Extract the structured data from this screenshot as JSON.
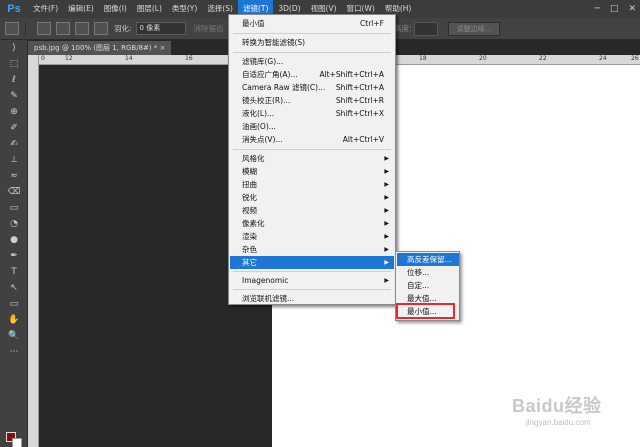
{
  "app": {
    "logo": "Ps"
  },
  "menubar": {
    "items": [
      "文件(F)",
      "编辑(E)",
      "图像(I)",
      "图层(L)",
      "类型(Y)",
      "选择(S)",
      "滤镜(T)",
      "3D(D)",
      "视图(V)",
      "窗口(W)",
      "帮助(H)"
    ],
    "active_index": 6
  },
  "window_controls": {
    "minimize": "─",
    "maximize": "□",
    "close": "✕"
  },
  "options_bar": {
    "feather_label": "羽化:",
    "feather_value": "0 像素",
    "antialias_label": "消除锯齿",
    "height_label": "高度:",
    "refine_edge_label": "调整边缘..."
  },
  "document": {
    "tab_title": "psb.jpg @ 100% (图层 1, RGB/8#) *",
    "tab_close": "×",
    "ruler_numbers": [
      "0",
      "12",
      "14",
      "16",
      "18",
      "20",
      "22",
      "24",
      "26"
    ]
  },
  "toolbox": {
    "tools": [
      "⟩",
      "⬚",
      "ℓ",
      "✎",
      "⊕",
      "✐",
      "✍",
      "⊥",
      "≈",
      "⌫",
      "▭",
      "◔",
      "●",
      "✒",
      "T",
      "↖",
      "▭",
      "✋",
      "🔍",
      "⋯"
    ],
    "foreground_color": "#8c0a0a",
    "background_color": "#ffffff"
  },
  "filter_menu": {
    "items": [
      {
        "label": "最小值",
        "shortcut": "Ctrl+F"
      },
      {
        "label": "转换为智能滤镜(S)"
      },
      {
        "label": "滤镜库(G)..."
      },
      {
        "label": "自适应广角(A)...",
        "shortcut": "Alt+Shift+Ctrl+A"
      },
      {
        "label": "Camera Raw 滤镜(C)...",
        "shortcut": "Shift+Ctrl+A"
      },
      {
        "label": "镜头校正(R)...",
        "shortcut": "Shift+Ctrl+R"
      },
      {
        "label": "液化(L)...",
        "shortcut": "Shift+Ctrl+X"
      },
      {
        "label": "油画(O)..."
      },
      {
        "label": "消失点(V)...",
        "shortcut": "Alt+Ctrl+V"
      },
      {
        "label": "风格化"
      },
      {
        "label": "模糊"
      },
      {
        "label": "扭曲"
      },
      {
        "label": "锐化"
      },
      {
        "label": "视频"
      },
      {
        "label": "像素化"
      },
      {
        "label": "渲染"
      },
      {
        "label": "杂色"
      },
      {
        "label": "其它"
      },
      {
        "label": "Imagenomic"
      },
      {
        "label": "浏览联机滤镜..."
      }
    ],
    "highlighted_index": 17,
    "submenu_arrow": "▶"
  },
  "submenu": {
    "items": [
      "高反差保留...",
      "位移...",
      "自定...",
      "最大值...",
      "最小值..."
    ],
    "highlighted_index": 0,
    "outlined_index": 4
  },
  "watermark": {
    "logo": "Baidu经验",
    "url": "jingyan.baidu.com"
  }
}
